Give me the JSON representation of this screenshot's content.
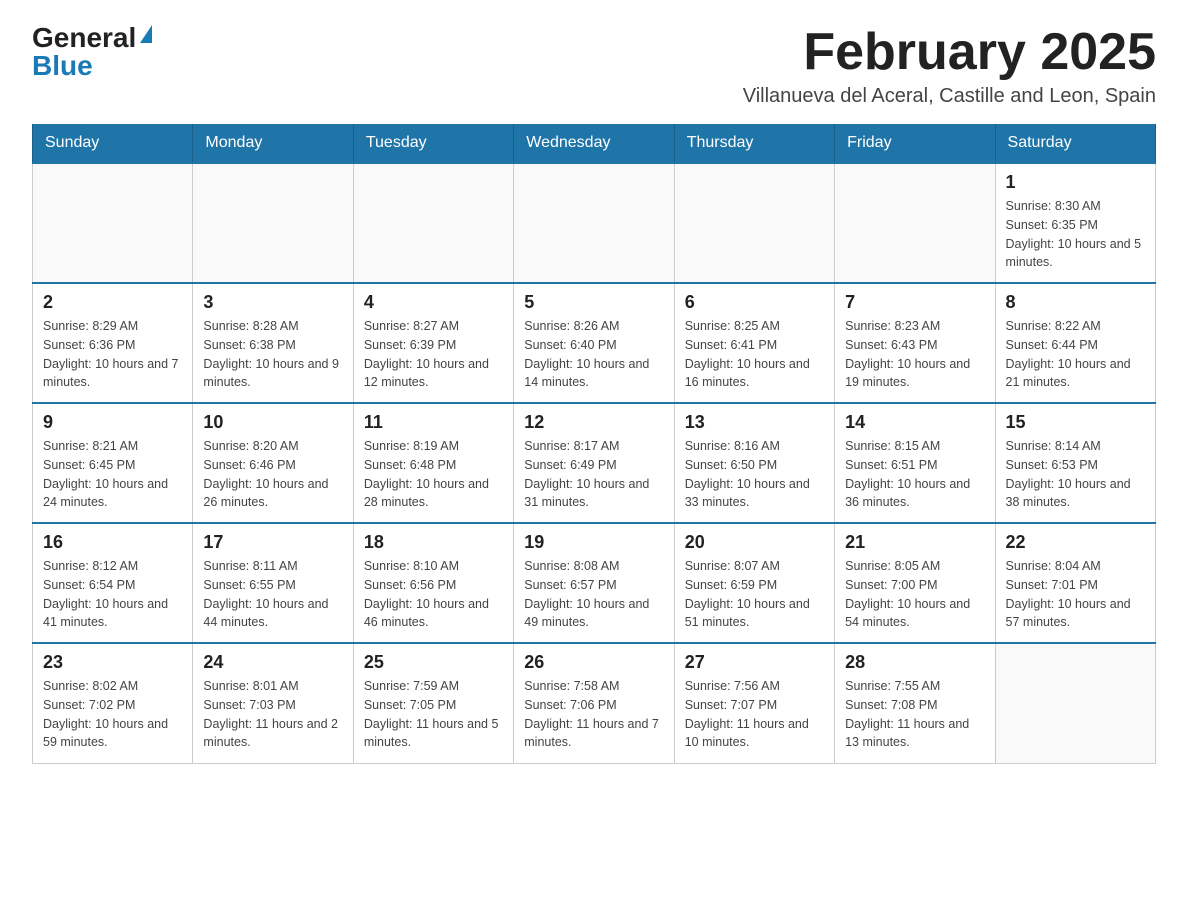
{
  "header": {
    "logo_general": "General",
    "logo_blue": "Blue",
    "title": "February 2025",
    "subtitle": "Villanueva del Aceral, Castille and Leon, Spain"
  },
  "days_of_week": [
    "Sunday",
    "Monday",
    "Tuesday",
    "Wednesday",
    "Thursday",
    "Friday",
    "Saturday"
  ],
  "weeks": [
    [
      {
        "day": "",
        "info": ""
      },
      {
        "day": "",
        "info": ""
      },
      {
        "day": "",
        "info": ""
      },
      {
        "day": "",
        "info": ""
      },
      {
        "day": "",
        "info": ""
      },
      {
        "day": "",
        "info": ""
      },
      {
        "day": "1",
        "info": "Sunrise: 8:30 AM\nSunset: 6:35 PM\nDaylight: 10 hours and 5 minutes."
      }
    ],
    [
      {
        "day": "2",
        "info": "Sunrise: 8:29 AM\nSunset: 6:36 PM\nDaylight: 10 hours and 7 minutes."
      },
      {
        "day": "3",
        "info": "Sunrise: 8:28 AM\nSunset: 6:38 PM\nDaylight: 10 hours and 9 minutes."
      },
      {
        "day": "4",
        "info": "Sunrise: 8:27 AM\nSunset: 6:39 PM\nDaylight: 10 hours and 12 minutes."
      },
      {
        "day": "5",
        "info": "Sunrise: 8:26 AM\nSunset: 6:40 PM\nDaylight: 10 hours and 14 minutes."
      },
      {
        "day": "6",
        "info": "Sunrise: 8:25 AM\nSunset: 6:41 PM\nDaylight: 10 hours and 16 minutes."
      },
      {
        "day": "7",
        "info": "Sunrise: 8:23 AM\nSunset: 6:43 PM\nDaylight: 10 hours and 19 minutes."
      },
      {
        "day": "8",
        "info": "Sunrise: 8:22 AM\nSunset: 6:44 PM\nDaylight: 10 hours and 21 minutes."
      }
    ],
    [
      {
        "day": "9",
        "info": "Sunrise: 8:21 AM\nSunset: 6:45 PM\nDaylight: 10 hours and 24 minutes."
      },
      {
        "day": "10",
        "info": "Sunrise: 8:20 AM\nSunset: 6:46 PM\nDaylight: 10 hours and 26 minutes."
      },
      {
        "day": "11",
        "info": "Sunrise: 8:19 AM\nSunset: 6:48 PM\nDaylight: 10 hours and 28 minutes."
      },
      {
        "day": "12",
        "info": "Sunrise: 8:17 AM\nSunset: 6:49 PM\nDaylight: 10 hours and 31 minutes."
      },
      {
        "day": "13",
        "info": "Sunrise: 8:16 AM\nSunset: 6:50 PM\nDaylight: 10 hours and 33 minutes."
      },
      {
        "day": "14",
        "info": "Sunrise: 8:15 AM\nSunset: 6:51 PM\nDaylight: 10 hours and 36 minutes."
      },
      {
        "day": "15",
        "info": "Sunrise: 8:14 AM\nSunset: 6:53 PM\nDaylight: 10 hours and 38 minutes."
      }
    ],
    [
      {
        "day": "16",
        "info": "Sunrise: 8:12 AM\nSunset: 6:54 PM\nDaylight: 10 hours and 41 minutes."
      },
      {
        "day": "17",
        "info": "Sunrise: 8:11 AM\nSunset: 6:55 PM\nDaylight: 10 hours and 44 minutes."
      },
      {
        "day": "18",
        "info": "Sunrise: 8:10 AM\nSunset: 6:56 PM\nDaylight: 10 hours and 46 minutes."
      },
      {
        "day": "19",
        "info": "Sunrise: 8:08 AM\nSunset: 6:57 PM\nDaylight: 10 hours and 49 minutes."
      },
      {
        "day": "20",
        "info": "Sunrise: 8:07 AM\nSunset: 6:59 PM\nDaylight: 10 hours and 51 minutes."
      },
      {
        "day": "21",
        "info": "Sunrise: 8:05 AM\nSunset: 7:00 PM\nDaylight: 10 hours and 54 minutes."
      },
      {
        "day": "22",
        "info": "Sunrise: 8:04 AM\nSunset: 7:01 PM\nDaylight: 10 hours and 57 minutes."
      }
    ],
    [
      {
        "day": "23",
        "info": "Sunrise: 8:02 AM\nSunset: 7:02 PM\nDaylight: 10 hours and 59 minutes."
      },
      {
        "day": "24",
        "info": "Sunrise: 8:01 AM\nSunset: 7:03 PM\nDaylight: 11 hours and 2 minutes."
      },
      {
        "day": "25",
        "info": "Sunrise: 7:59 AM\nSunset: 7:05 PM\nDaylight: 11 hours and 5 minutes."
      },
      {
        "day": "26",
        "info": "Sunrise: 7:58 AM\nSunset: 7:06 PM\nDaylight: 11 hours and 7 minutes."
      },
      {
        "day": "27",
        "info": "Sunrise: 7:56 AM\nSunset: 7:07 PM\nDaylight: 11 hours and 10 minutes."
      },
      {
        "day": "28",
        "info": "Sunrise: 7:55 AM\nSunset: 7:08 PM\nDaylight: 11 hours and 13 minutes."
      },
      {
        "day": "",
        "info": ""
      }
    ]
  ]
}
